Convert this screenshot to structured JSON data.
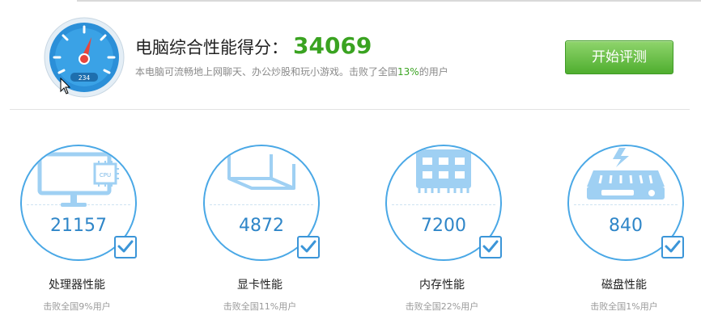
{
  "header": {
    "score_title": "电脑综合性能得分：",
    "score_value": "34069",
    "subtitle_prefix": "本电脑可流畅地上网聊天、办公炒股和玩小游戏。击败了全国",
    "subtitle_percent": "13%",
    "subtitle_suffix": "的用户",
    "start_button": "开始评测",
    "gauge_readout": "234"
  },
  "colors": {
    "accent_green": "#3aa321",
    "ring_blue": "#4aa8e6",
    "value_blue": "#2f86c8",
    "gauge_red": "#e8453c"
  },
  "cards": [
    {
      "icon": "monitor-cpu-icon",
      "chip_label": "CPU",
      "value": "21157",
      "name": "处理器性能",
      "sub": "击败全国9%用户"
    },
    {
      "icon": "graphics-card-icon",
      "value": "4872",
      "name": "显卡性能",
      "sub": "击败全国11%用户"
    },
    {
      "icon": "memory-module-icon",
      "value": "7200",
      "name": "内存性能",
      "sub": "击败全国22%用户"
    },
    {
      "icon": "hard-disk-icon",
      "value": "840",
      "name": "磁盘性能",
      "sub": "击败全国1%用户"
    }
  ]
}
